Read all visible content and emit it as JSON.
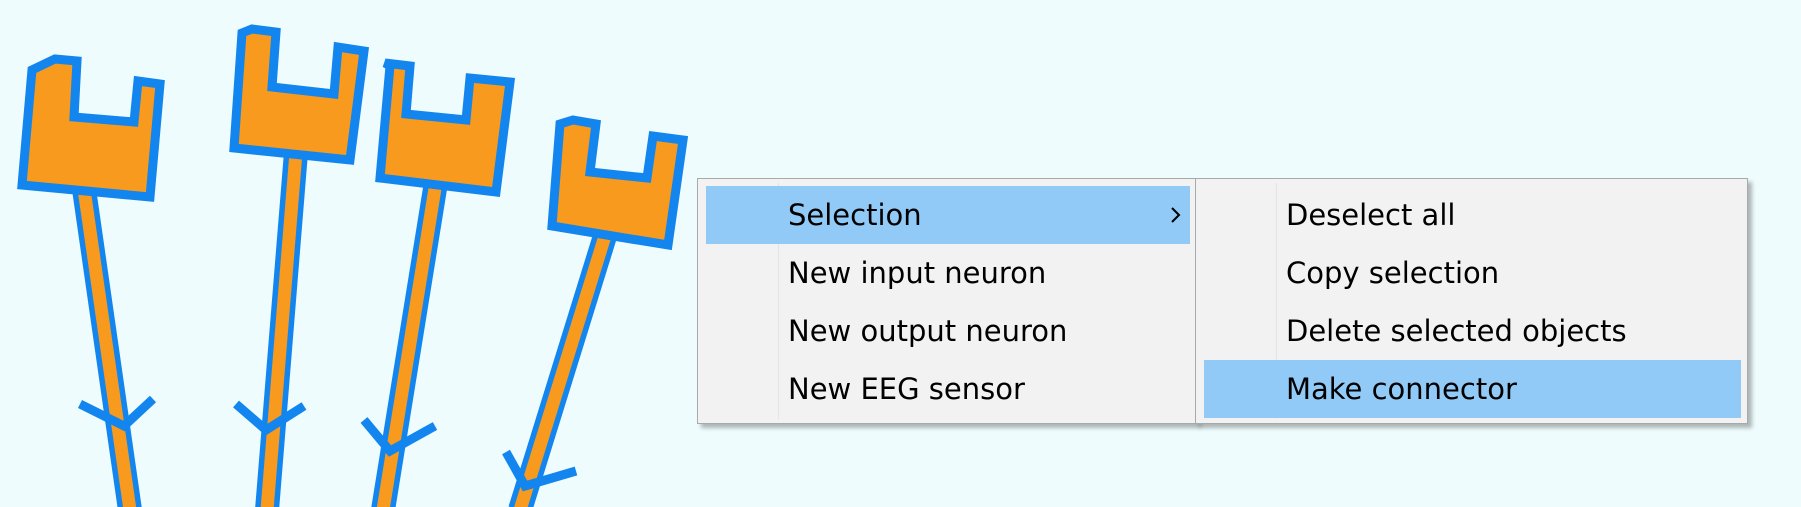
{
  "colors": {
    "canvas_background": "#EEFCFD",
    "neuron_fill": "#F79A1E",
    "neuron_outline": "#1385EE",
    "menu_background": "#F2F2F2",
    "menu_highlight": "#91C9F7",
    "menu_text": "#000000"
  },
  "context_menu": {
    "items": [
      {
        "label": "Selection",
        "has_submenu": true,
        "highlighted": true,
        "submenu_icon": "chevron-right-icon"
      },
      {
        "label": "New input neuron",
        "has_submenu": false,
        "highlighted": false
      },
      {
        "label": "New output neuron",
        "has_submenu": false,
        "highlighted": false
      },
      {
        "label": "New EEG sensor",
        "has_submenu": false,
        "highlighted": false
      }
    ]
  },
  "selection_submenu": {
    "items": [
      {
        "label": "Deselect all",
        "highlighted": false
      },
      {
        "label": "Copy selection",
        "highlighted": false
      },
      {
        "label": "Delete selected objects",
        "highlighted": false
      },
      {
        "label": "Make connector",
        "highlighted": true
      }
    ]
  }
}
